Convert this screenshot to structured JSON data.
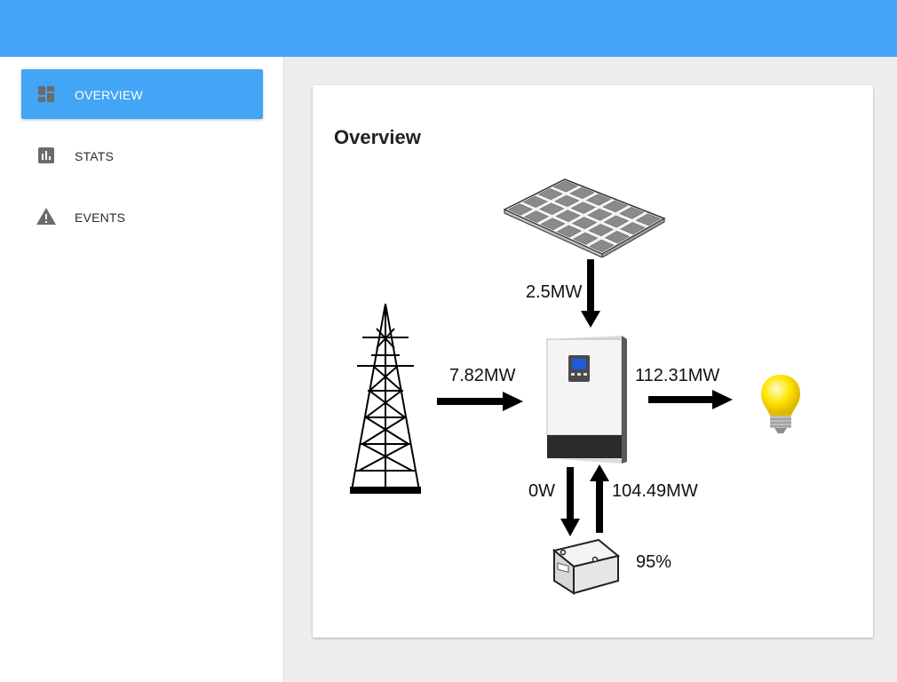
{
  "nav": {
    "items": [
      {
        "label": "OVERVIEW",
        "icon": "dashboard-icon",
        "active": true
      },
      {
        "label": "STATS",
        "icon": "bar-chart-icon",
        "active": false
      },
      {
        "label": "EVENTS",
        "icon": "warning-icon",
        "active": false
      }
    ]
  },
  "main": {
    "title": "Overview",
    "flows": {
      "solar_to_inverter": "2.5MW",
      "grid_to_inverter": "7.82MW",
      "inverter_to_load": "112.31MW",
      "inverter_to_battery": "0W",
      "battery_to_inverter": "104.49MW"
    },
    "battery_level": "95%"
  },
  "colors": {
    "appbar": "#42a5f5",
    "active_nav": "#42a5f5",
    "background": "#eeeeee"
  }
}
